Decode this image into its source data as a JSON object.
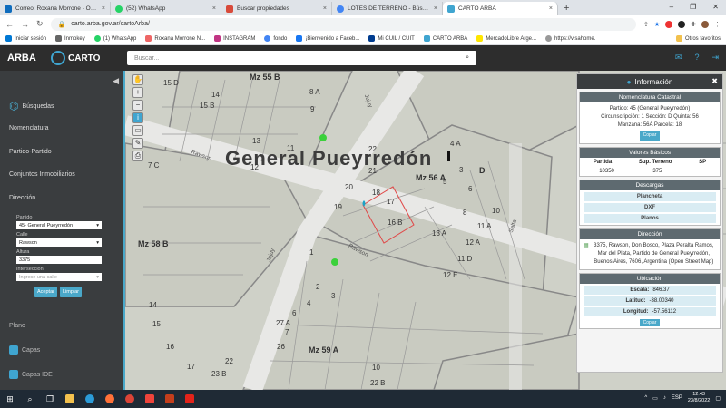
{
  "browser": {
    "tabs": [
      {
        "label": "Correo: Roxana Morrone - Outlo",
        "color": "#0f6cbd"
      },
      {
        "label": "(52) WhatsApp",
        "color": "#25d366"
      },
      {
        "label": "Buscar propiedades",
        "color": "#d84a3a"
      },
      {
        "label": "LOTES DE TERRENO - Búsqueda",
        "color": "#4285f4"
      },
      {
        "label": "CARTO ARBA",
        "color": "#3fa5d0",
        "active": true
      }
    ],
    "new_tab": "+",
    "url": "carto.arba.gov.ar/cartoArba/",
    "bookmarks": [
      {
        "label": "Iniciar sesión",
        "color": "#0078d4"
      },
      {
        "label": "Inmokey",
        "color": "#666"
      },
      {
        "label": "(1) WhatsApp",
        "color": "#25d366"
      },
      {
        "label": "Roxana Morrone N...",
        "color": "#e66"
      },
      {
        "label": "INSTAGRAM",
        "color": "#c13584"
      },
      {
        "label": "fondo",
        "color": "#4285f4"
      },
      {
        "label": "¡Bienvenido a Faceb...",
        "color": "#1877f2"
      },
      {
        "label": "Mi CUIL / CUIT",
        "color": "#003c8f"
      },
      {
        "label": "CARTO ARBA",
        "color": "#3fa5d0"
      },
      {
        "label": "MercadoLibre Arge...",
        "color": "#ffe600"
      },
      {
        "label": "https://visahome.",
        "color": "#999"
      }
    ],
    "other_bookmarks": "Otros favoritos"
  },
  "app": {
    "brand": "ARBA",
    "carto": "CARTO",
    "search_placeholder": "Buscar..."
  },
  "sidebar": {
    "items": [
      "Búsquedas",
      "Nomenclatura",
      "Partido-Partido",
      "Conjuntos Inmobiliarios",
      "Dirección"
    ],
    "form": {
      "partido_label": "Partido",
      "partido_value": "45- General Pueyrredón",
      "calle_label": "Calle",
      "calle_value": "Rawson",
      "altura_label": "Altura",
      "altura_value": "3375",
      "interseccion_label": "Intersección",
      "interseccion_placeholder": "Ingrese una calle",
      "aceptar": "Aceptar",
      "limpiar": "Limpiar"
    },
    "plano": "Plano",
    "capas": "Capas",
    "capas_ide": "Capas IDE"
  },
  "map": {
    "partido_label": "General Pueyrredón",
    "manzanas": [
      "Mz 55 B",
      "Mz 56 A",
      "Mz 58 B",
      "Mz 59 A"
    ],
    "streets": [
      "Jujuy",
      "Rawson",
      "Rawson",
      "Jujuy",
      "Salta"
    ],
    "lots": [
      "15 D",
      "14",
      "8 A",
      "15 B",
      "9",
      "13",
      "11",
      "12",
      "22",
      "21",
      "20",
      "18",
      "17",
      "19",
      "16 B",
      "4 A",
      "3",
      "5",
      "6",
      "8",
      "10",
      "11 A",
      "13 A",
      "12 A",
      "12 E",
      "11 D",
      "1",
      "2",
      "3",
      "4",
      "6",
      "7",
      "14",
      "15",
      "16",
      "17",
      "26",
      "27 A",
      "22",
      "23 B",
      "22 B",
      "10",
      "7 C"
    ],
    "side_letter": "D"
  },
  "info_panel": {
    "title": "Información",
    "nomenclatura": {
      "title": "Nomenclatura Catastral",
      "line1": "Partido: 45 (General Pueyrredón)",
      "line2": "Circunscripción: 1 Sección: D Quinta: 56",
      "line3": "Manzana: 56A Parcela: 18",
      "copy": "Copiar"
    },
    "valores": {
      "title": "Valores Básicos",
      "headers": [
        "Partida",
        "Sup. Terreno",
        "SP"
      ],
      "values": [
        "10350",
        "375",
        ""
      ]
    },
    "descargas": {
      "title": "Descargas",
      "items": [
        "Plancheta",
        "DXF",
        "Planos"
      ]
    },
    "direccion": {
      "title": "Dirección",
      "text": "3375, Rawson, Don Bosco, Plaza Peralta Ramos, Mar del Plata, Partido de General Pueyrredón, Buenos Aires, 7606, Argentina (Open Street Map)"
    },
    "ubicacion": {
      "title": "Ubicación",
      "escala_label": "Escala:",
      "escala": "846.37",
      "lat_label": "Latitud:",
      "lat": "-38.00340",
      "lon_label": "Longitud:",
      "lon": "-57.56112",
      "copy": "Copiar"
    }
  },
  "taskbar": {
    "lang": "ESP",
    "time": "12:43",
    "date": "23/8/2022"
  }
}
